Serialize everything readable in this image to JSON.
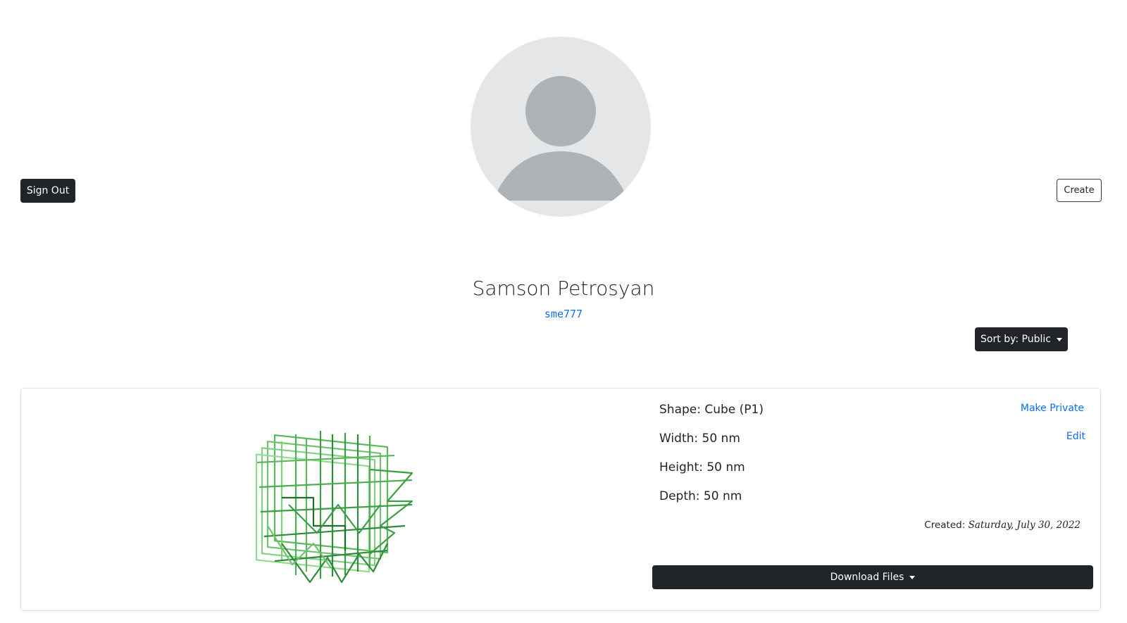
{
  "header": {
    "sign_out_label": "Sign Out",
    "create_label": "Create"
  },
  "profile": {
    "full_name": "Samson Petrosyan",
    "username": "sme777"
  },
  "sort": {
    "label": "Sort by: Public"
  },
  "design_card": {
    "shape": "Shape: Cube (P1)",
    "width": "Width: 50 nm",
    "height": "Height: 50 nm",
    "depth": "Depth: 50 nm",
    "make_private_label": "Make Private",
    "edit_label": "Edit",
    "created_prefix": "Created:",
    "created_date": "Saturday, July 30, 2022",
    "download_label": "Download Files"
  },
  "colors": {
    "dark": "#212529",
    "link": "#0d6efd",
    "avatar_bg": "#e4e6e8",
    "avatar_fg": "#adb2b6"
  }
}
